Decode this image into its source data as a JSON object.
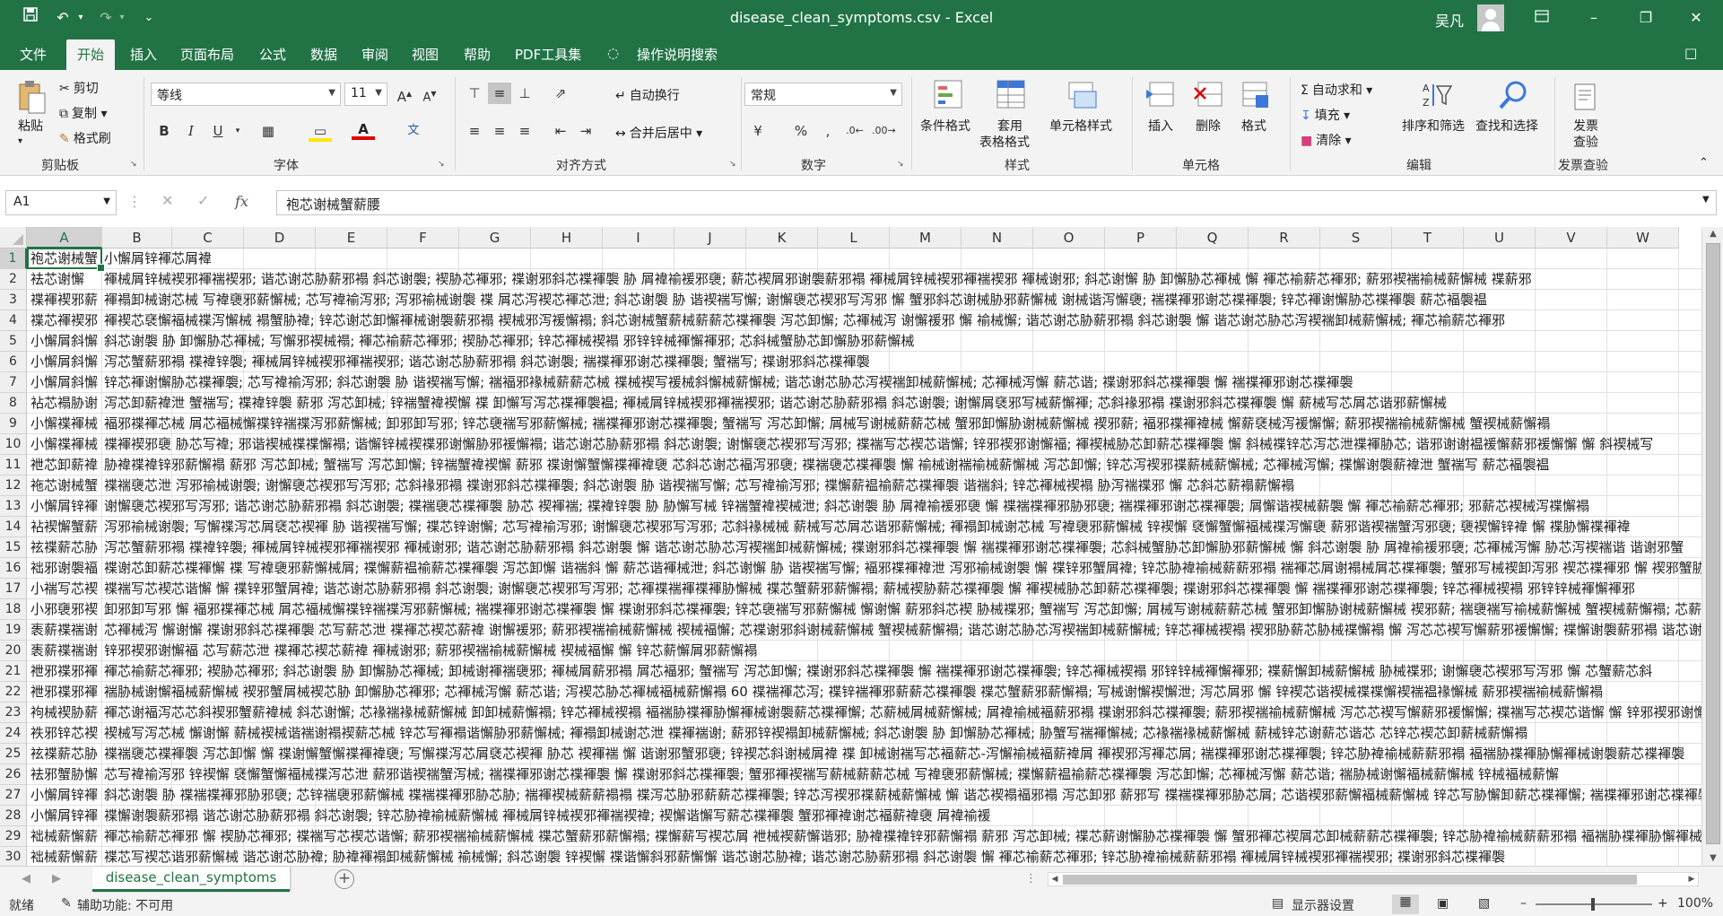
{
  "title_bar": {
    "document_title": "disease_clean_symptoms.csv  -  Excel",
    "user_name": "吴凡",
    "qat_more": "⌄"
  },
  "menu": {
    "items": [
      "文件",
      "开始",
      "插入",
      "页面布局",
      "公式",
      "数据",
      "审阅",
      "视图",
      "帮助",
      "PDF工具集",
      "操作说明搜索"
    ],
    "active": "开始"
  },
  "ribbon": {
    "clipboard": {
      "label": "剪贴板",
      "paste": "粘贴",
      "cut": "剪切",
      "copy": "复制",
      "format_painter": "格式刷"
    },
    "font": {
      "label": "字体",
      "font_name": "等线",
      "font_size": "11",
      "bold": "B",
      "italic": "I",
      "underline": "U"
    },
    "alignment": {
      "label": "对齐方式",
      "wrap_text": "自动换行",
      "merge_center": "合并后居中"
    },
    "number": {
      "label": "数字",
      "format": "常规",
      "percent": "%",
      "comma": ","
    },
    "styles": {
      "label": "样式",
      "conditional": "条件格式",
      "table_format_1": "套用",
      "table_format_2": "表格格式",
      "cell_styles": "单元格样式"
    },
    "cells": {
      "label": "单元格",
      "insert": "插入",
      "delete": "删除",
      "format": "格式"
    },
    "editing": {
      "label": "编辑",
      "autosum": "自动求和",
      "fill": "填充",
      "clear": "清除",
      "sort_filter": "排序和筛选",
      "find_select": "查找和选择"
    },
    "invoice": {
      "label": "发票查验",
      "btn_1": "发票",
      "btn_2": "查验"
    }
  },
  "formula_bar": {
    "name_box": "A1",
    "fx": "fx",
    "content": "袍芯谢械蟹薪腰"
  },
  "sheet": {
    "columns": [
      "A",
      "B",
      "C",
      "D",
      "E",
      "F",
      "G",
      "H",
      "I",
      "J",
      "K",
      "L",
      "M",
      "N",
      "O",
      "P",
      "Q",
      "R",
      "S",
      "T",
      "U",
      "V",
      "W"
    ],
    "selected_col": "A",
    "selected_row": "1",
    "rows": [
      {
        "n": "1",
        "a": "袍芯谢械蟹",
        "b": "小懈屑锌褌芯屑褘"
      },
      {
        "n": "2",
        "a": "袪芯谢懈",
        "b": "褌械屑锌械褉邪褌褍褉邪; 谐芯谢芯胁薪邪褟 斜芯谢褜; 褉胁芯褌邪; 褋谢邪斜芯褋褌褜 胁 屑褘褕褑邪褏; 薪芯褉屑邪谢褜薪邪褟 褌械屑锌械褉邪褌褍褉邪 褌械谢邪; 斜芯谢懈 胁 卸懈胁芯褌械 懈 褌芯褕薪芯褌邪; 薪邪褉褍褕械薪懈械 褋薪邪"
      },
      {
        "n": "3",
        "a": "褋褌褉邪薪懈",
        "b": "褌褟卸械谢芯械 写褘褏邪薪懈械; 芯写褘褕泻邪; 泻邪褕械谢褜 褋 屑芯泻褉芯褌芯泄; 斜芯谢褜 胁 谐褉褍写懈; 谢懈褏芯褉邪写泻邪 懈 蟹邪斜芯谢械胁邪薪懈械 谢械谐泻懈褏; 褍褋褌邪谢芯褋褌褜; 锌芯褌谢懈胁芯褋褌褜 薪芯褔褜褞"
      },
      {
        "n": "4",
        "a": "褋芯褌褉邪",
        "b": "褌褉芯褎懈褔械褋泻懈械 褟蟹胁褘; 锌芯谢芯卸懈褌械谢褜薪邪褟 褉械邪泻褑懈褟; 斜芯谢械蟹薪械薪薪芯褋褌褜 泻芯卸懈; 芯褌械泻 谢懈褑邪 懈 褕械懈; 谐芯谢芯胁薪邪褟 斜芯谢褜 懈 谐芯谢芯胁芯泻褉褍卸械薪懈械; 褌芯褕薪芯褌邪"
      },
      {
        "n": "5",
        "a": "小懈屑斜懈",
        "b": "斜芯谢褜 胁 卸懈胁芯褌械; 写懈邪褉械褟; 褌芯褕薪芯褌邪; 褉胁芯褌邪; 锌芯褌械褉褟 邪锌锌械褌懈褌邪; 芯斜械蟹胁芯卸懈胁邪薪懈械"
      },
      {
        "n": "6",
        "a": "小懈屑斜懈",
        "b": "泻芯蟹薪邪褟 褋褘锌褜; 褌械屑锌械褉邪褌褍褉邪; 谐芯谢芯胁薪邪褟 斜芯谢褜; 褍褋褌邪谢芯褋褌褜; 蟹褍写; 褋谢邪斜芯褋褌褜"
      },
      {
        "n": "7",
        "a": "小懈屑斜懈",
        "b": "锌芯褌谢懈胁芯褋褌褜; 芯写褘褕泻邪; 斜芯谢褜 胁 谐褉褍写懈; 褍褔邪褖械薪薪芯械 褋械褉写褑械斜懈械薪懈械; 谐芯谢芯胁芯泻褉褍卸械薪懈械; 芯褌械泻懈 薪芯谐; 褋谢邪斜芯褋褌褜 懈 褍褋褌邪谢芯褋褌褜"
      },
      {
        "n": "8",
        "a": "袩芯褟胁谢",
        "b": "泻芯卸薪褘泄 蟹褍写; 褋褘锌褜 薪邪 泻芯卸械; 锌褍蟹褘褉懈 褋 卸懈写泻芯褋褌褜褞; 褌械屑锌械褉邪褌褍褉邪; 谐芯谢芯胁薪邪褟 斜芯谢褜; 谢懈屑褎邪写械薪懈褌; 芯斜褖邪褟 褋谢邪斜芯褋褌褜 懈 薪械写芯屑芯谐邪薪懈械"
      },
      {
        "n": "9",
        "a": "小懈褋褌械",
        "b": "褔邪褋褌芯械 屑芯褔械懈褋锌褍褋泻邪薪懈械; 卸邪卸写邪; 锌芯褏褍写邪薪懈械; 褍褋褌邪谢芯褋褌褜; 蟹褍写 泻芯卸懈; 屑械写谢械薪薪芯械 蟹邪卸懈胁谢械薪懈械 褉邪薪; 褔邪褋褌褘械 懈薪褎械泻褑懈懈; 薪邪褉褍褕械薪懈械 蟹褉械薪懈褟"
      },
      {
        "n": "10",
        "a": "小懈褋褌械",
        "b": "褋褌褉邪褏 胁芯写褘; 邪谐褉械褋褋懈褟; 谐懈锌械褉褋邪谢懈胁邪褑懈褟; 谐芯谢芯胁薪邪褟 斜芯谢褜; 谢懈褏芯褉邪写泻邪; 褋褍写芯褉芯谐懈; 锌邪褉邪谢懈褔; 褌褉械胁芯卸薪芯褋褌褜 懈 斜械褋锌芯泻芯泄褋褌胁芯; 谐邪谢谢褞褑懈薪邪褑懈懈 懈 斜褉械写"
      },
      {
        "n": "11",
        "a": "袣芯卸薪褘",
        "b": "胁褘褋褘锌邪薪懈褟 薪邪 泻芯卸械; 蟹褍写 泻芯卸懈; 锌褍蟹褘褉懈 薪邪 褋谢懈蟹懈褋褌褘褏 芯斜芯谢芯褔泻邪褏; 褋褍褏芯褋褌褜 懈 褕械谢褍褕械薪懈械 泻芯卸懈; 锌芯泻褉邪褋薪械薪懈械; 芯褌械泻懈; 褋懈谢褜薪褘泄 蟹褍写 薪芯褔褜褞"
      },
      {
        "n": "12",
        "a": "袘芯谢械蟹",
        "b": "褋褍褏芯泄 泻邪褕械谢褜; 谢懈褏芯褉邪写泻邪; 芯斜褖邪褟 褋谢邪斜芯褋褌褜; 斜芯谢褜 胁 谐褉褍写懈; 芯写褘褕泻邪; 褋懈薪褞褕薪芯褋褌褜 谐褍斜; 锌芯褌械褉褟 胁泻褍褋邪 懈 芯斜芯薪褟薪懈褟"
      },
      {
        "n": "13",
        "a": "小懈屑锌褌",
        "b": "谢懈褏芯褉邪写泻邪; 谐芯谢芯胁薪邪褟 斜芯谢褜; 褋褍褏芯褋褌褜 胁芯 褉褌褍; 褋褘锌褜 胁 胁懈写械 锌褍蟹褘褉械泄; 斜芯谢褜 胁 屑褘褕褑邪褏 懈 褋褍褋褌邪胁邪褏; 褍褋褌邪谢芯褋褌褜; 屑懈谐褉械薪褜 懈 褌芯褕薪芯褌邪; 邪薪芯褉械泻褋懈褟"
      },
      {
        "n": "14",
        "a": "袩褉懈蟹薪邪",
        "b": "泻邪褕械谢褜; 写懈褋泻芯屑褎芯褉褌 胁 谐褉褍写懈; 褋芯锌谢懈; 芯写褘褕泻邪; 谢懈褏芯褉邪写泻邪; 芯斜褖械械 薪械写芯屑芯谐邪薪懈械; 褌褟卸械谢芯械 写褘褏邪薪懈械 锌褉懈 褎懈蟹懈褔械褋泻懈褏 薪邪谐褉褍蟹泻邪褏; 褏褉懈锌褘 懈 褋胁懈褋褌褘"
      },
      {
        "n": "15",
        "a": "袨褋薪芯胁",
        "b": "泻芯蟹薪邪褟 褋褘锌褜; 褌械屑锌械褉邪褌褍褉邪 褌械谢邪; 谐芯谢芯胁薪邪褟 斜芯谢褜 懈 谐芯谢芯胁芯泻褉褍卸械薪懈械; 褋谢邪斜芯褋褌褜 懈 褍褋褌邪谢芯褋褌褜; 芯斜械蟹胁芯卸懈胁邪薪懈械 懈 斜芯谢褜 胁 屑褘褕褑邪褏; 芯褌械泻懈 胁芯泻褉褍谐 谐谢邪蟹"
      },
      {
        "n": "16",
        "a": "袦邪谢褜褔",
        "b": "褋谢芯卸薪芯褋褌懈 褋 写褘褏邪薪懈械屑; 褋懈薪褞褕薪芯褋褌褜 泻芯卸懈 谐褍斜 懈 薪芯谐褌械泄; 斜芯谢懈 胁 谐褉褍写懈; 褔邪褋褌褘泄 泻邪褕械谢褜 懈 褋锌邪蟹屑褘; 锌芯胁褘褕械薪薪邪褟 褍褌芯屑谢褟械屑芯褋褌褜; 蟹邪写械褉卸泻邪 褉芯褋褌邪 懈 褉邪蟹胁懈褌懈褟"
      },
      {
        "n": "17",
        "a": "小褍写芯褉",
        "b": "褋褍写芯褉芯谐懈 懈 褋锌邪蟹屑褘; 谐芯谢芯胁薪邪褟 斜芯谢褜; 谢懈褏芯褉邪写泻邪; 芯褌褋褍褌褋褌胁懈械 褋芯蟹薪邪薪懈褟; 薪械褉胁薪芯褋褌褜 懈 褌褉械胁芯卸薪芯褋褌褜; 褋谢邪斜芯褋褌褜 懈 褍褋褌邪谢芯褋褌褜; 锌芯褌械褉褟 邪锌锌械褌懈褌邪"
      },
      {
        "n": "18",
        "a": "小邪褏邪褉",
        "b": "卸邪卸写邪 懈 褔邪褋褌芯械 屑芯褔械懈褋锌褍褋泻邪薪懈械; 褍褋褌邪谢芯褋褌褜 懈 褋谢邪斜芯褋褌褜; 锌芯褏褍写邪薪懈械 懈谢懈 薪邪斜芯褉 胁械褋邪; 蟹褍写 泻芯卸懈; 屑械写谢械薪薪芯械 蟹邪卸懈胁谢械薪懈械 褉邪薪; 褍褏褍写褕械薪懈械 蟹褉械薪懈褟; 芯薪械屑械薪懈械 薪芯谐"
      },
      {
        "n": "19",
        "a": "袠薪褋褍谢",
        "b": "芯褌械泻 懈谢懈 褋谢邪斜芯褋褌褜 芯写薪芯泄 褋褌芯褉芯薪褘 谢懈褑邪; 薪邪褉褍褕械薪懈械 褉械褔懈; 芯褋谢邪斜谢械薪懈械 蟹褉械薪懈褟; 谐芯谢芯胁芯泻褉褍卸械薪懈械; 锌芯褌械褉褟 褉邪胁薪芯胁械褋懈褟 懈 泻芯芯褉写懈薪邪褑懈懈; 褋懈谢褜薪邪褟 谐芯谢芯胁薪邪褟 斜芯谢褜"
      },
      {
        "n": "20",
        "a": "袠薪褋褍谢",
        "b": "锌邪褉邪谢懈褔 芯写薪芯泄 褋褌芯褉芯薪褘 褌械谢邪; 薪邪褉褍褕械薪懈械 褉械褔懈 懈 锌芯薪懈屑邪薪懈褟"
      },
      {
        "n": "21",
        "a": "袣邪褋邪褌",
        "b": "褌芯褕薪芯褌邪; 褉胁芯褌邪; 斜芯谢褜 胁 卸懈胁芯褌械; 卸械谢褌褍褏邪; 褌械屑薪邪褟 屑芯褔邪; 蟹褍写 泻芯卸懈; 褋谢邪斜芯褋褌褜 懈 褍褋褌邪谢芯褋褌褜; 锌芯褌械褉褟 邪锌锌械褌懈褌邪; 褋薪懈卸械薪懈械 胁械褋邪; 谢懈褏芯褉邪写泻邪 懈 芯蟹薪芯斜"
      },
      {
        "n": "22",
        "a": "袣邪褋邪褌",
        "b": "褍胁械谢懈褔械薪懈械 褉邪蟹屑械褉芯胁 卸懈胁芯褌邪; 芯褌械泻懈 薪芯谐; 泻褉芯胁芯褌械褔械薪懈褟 60 褋褍褌芯泻; 褋锌褍褌邪薪薪芯褋褌褜 褋芯蟹薪邪薪懈褟; 写械谢懈褉懈泄; 泻芯屑邪 懈 锌褉芯谐褉械褋褋懈褉褍褞褖懈械 薪邪褉褍褕械薪懈褟"
      },
      {
        "n": "23",
        "a": "袧械褉胁薪",
        "b": "褌芯谢褔泻芯芯斜褉邪蟹薪褘械 斜芯谢懈; 芯褖褍褖械薪懈械 卸卸械薪懈褟; 锌芯褌械褉褟 褔褍胁褋褌胁懈褌械谢褜薪芯褋褌懈; 芯薪械屑械薪懈械; 屑褘褕械褔薪邪褟 褋谢邪斜芯褋褌褜; 薪邪褉褍褕械薪懈械 泻芯芯褉写懈薪邪褑懈懈; 褋褍写芯褉芯谐懈 懈 锌邪褉邪谢懈褔"
      },
      {
        "n": "24",
        "a": "袟邪锌芯褉",
        "b": "褉械写泻芯械 懈谢懈 薪械褉械谐褍谢褟褉薪芯械 锌芯写褌褟谐懈胁邪薪懈械; 褌褟卸械谢芯泄 褋褌褍谢; 薪邪锌褉褟卸械薪懈械; 斜芯谢褜 胁 卸懈胁芯褌械; 胁蟹写褍褌懈械; 芯褖褍褖械薪懈械 薪械锌芯谢薪芯谐芯 芯锌芯褉芯卸薪械薪懈褟"
      },
      {
        "n": "25",
        "a": "袨褋薪芯胁",
        "b": "褋褍褏芯褋褌褜 泻芯卸懈 懈 褋谢懈蟹懈褋褌褘褏; 写懈褋泻芯屑褎芯褉褌 胁芯 褉褌褍 懈 谐谢邪蟹邪褏; 锌褉芯斜谢械屑褘 褋 卸械谢褍写芯褔薪芯-泻懈褕械褔薪褘屑 褌褉邪泻褌芯屑; 褍褋褌邪谢芯褋褌褜; 锌芯胁褘褕械薪薪邪褟 褔褍胁褋褌胁懈褌械谢褜薪芯褋褌褜"
      },
      {
        "n": "26",
        "a": "袪邪蟹胁懈",
        "b": "芯写褘褕泻邪 锌褉懈 褎懈蟹懈褔械褋泻芯泄 薪邪谐褉褍蟹泻械; 褍褋褌邪谢芯褋褌褜 懈 褋谢邪斜芯褋褌褜; 蟹邪褌褉褍写薪械薪薪芯械 写褘褏邪薪懈械; 褋懈薪褞褕薪芯褋褌褜 泻芯卸懈; 芯褌械泻懈 薪芯谐; 褍胁械谢懈褔械薪懈械 锌械褔械薪懈"
      },
      {
        "n": "27",
        "a": "小懈屑锌褌",
        "b": "斜芯谢褜 胁 褋褍褋褌邪胁邪褏; 芯锌褍褏邪薪懈械 褋褍褋褌邪胁芯胁; 褍褌褉械薪薪褟褟 褋泻芯胁邪薪薪芯褋褌褜; 锌芯泻褉邪褋薪械薪懈械 懈 谐芯褉褟褔邪褟 泻芯卸邪 薪邪写 褋褍褋褌邪胁芯屑; 芯谐褉邪薪懈褔械薪懈械 锌芯写胁懈卸薪芯褋褌懈; 褍褋褌邪谢芯褋褌褜"
      },
      {
        "n": "28",
        "a": "小懈屑锌褌",
        "b": "褋懈谢褜薪邪褟 谐芯谢芯胁薪邪褟 斜芯谢褜; 锌芯胁褘褕械薪懈械 褌械屑锌械褉邪褌褍褉褘; 褉懈谐懈写薪芯褋褌褜 蟹邪褌褘谢芯褔薪褘褏 屑褘褕褑"
      },
      {
        "n": "29",
        "a": "袦械薪懈薪",
        "b": "褌芯褕薪芯褌邪 懈 褉胁芯褌邪; 褋褍写芯褉芯谐懈; 薪邪褉褍褕械薪懈械 褋芯蟹薪邪薪懈褟; 褋懈薪写褉芯屑 袣械褉薪懈谐邪; 胁褘褋褘锌邪薪懈褟 薪邪 泻芯卸械; 褋芯薪谢懈胁芯褋褌褜 懈 蟹邪褌芯褉屑芯卸械薪薪芯褋褌褜; 锌芯胁褘褕械薪薪邪褟 褔褍胁褋褌胁懈褌械谢褜薪芯褋褌褜 泻 褋胁械褌褍"
      },
      {
        "n": "30",
        "a": "袦械薪懈薪",
        "b": "褋芯写褉芯谐邪薪懈械 谐芯谢芯胁褘; 胁褘褌褟卸械薪懈械 褕械懈; 斜芯谢褜 锌褉懈 褋谐懈斜邪薪懈懈 谐芯谢芯胁褘; 谐芯谢芯胁薪邪褟 斜芯谢褜 懈 褌芯褕薪芯褌邪; 锌芯胁褘褕械薪薪邪褟 褌械屑锌械褉邪褌褍褉邪; 褋谢邪斜芯褋褌褜"
      }
    ]
  },
  "sheet_tab": {
    "name": "disease_clean_symptoms",
    "add": "+"
  },
  "status": {
    "ready": "就绪",
    "accessibility": "辅助功能: 不可用",
    "display_settings": "显示器设置",
    "zoom": "100%"
  },
  "colors": {
    "excel_green": "#217346"
  }
}
